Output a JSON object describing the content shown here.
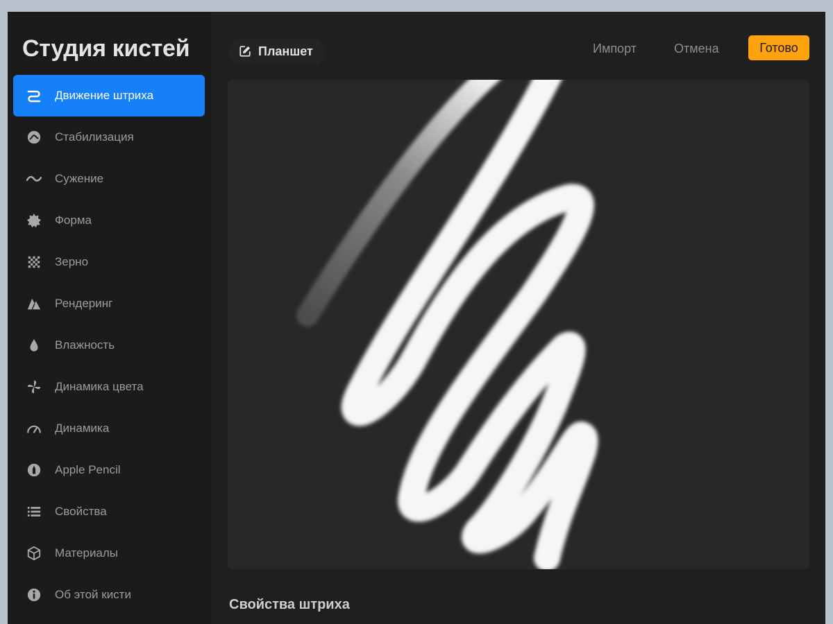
{
  "app": {
    "title": "Студия кистей"
  },
  "sidebar": {
    "items": [
      {
        "label": "Движение штриха",
        "icon": "stroke-path-icon",
        "active": true
      },
      {
        "label": "Стабилизация",
        "icon": "stabilization-icon"
      },
      {
        "label": "Сужение",
        "icon": "taper-icon"
      },
      {
        "label": "Форма",
        "icon": "shape-icon"
      },
      {
        "label": "Зерно",
        "icon": "grain-icon"
      },
      {
        "label": "Рендеринг",
        "icon": "rendering-icon"
      },
      {
        "label": "Влажность",
        "icon": "wet-mix-icon"
      },
      {
        "label": "Динамика цвета",
        "icon": "color-dynamics-icon"
      },
      {
        "label": "Динамика",
        "icon": "dynamics-icon"
      },
      {
        "label": "Apple Pencil",
        "icon": "apple-pencil-icon"
      },
      {
        "label": "Свойства",
        "icon": "properties-icon"
      },
      {
        "label": "Материалы",
        "icon": "materials-icon"
      },
      {
        "label": "Об этой кисти",
        "icon": "info-icon"
      }
    ]
  },
  "header": {
    "pad_label": "Планшет",
    "import_label": "Импорт",
    "cancel_label": "Отмена",
    "done_label": "Готово"
  },
  "main": {
    "section_title": "Свойства штриха"
  },
  "colors": {
    "accent": "#1580f7",
    "done": "#fea20d"
  }
}
